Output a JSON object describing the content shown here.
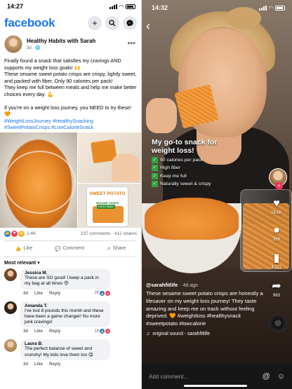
{
  "facebook": {
    "status": {
      "time": "14:27"
    },
    "logo": "facebook",
    "header_icons": [
      "plus-icon",
      "search-icon",
      "messenger-icon"
    ],
    "post": {
      "author": "Healthy Habits with Sarah",
      "time": "3d · ",
      "paragraphs": [
        "Finally found a snack that satisfies my cravings AND supports my weight loss goals! 🙌",
        "These sesame sweet potato crisps are crispy, lightly sweet, and packed with fiber. Only 90 calories per pack!",
        "They keep me full between meals and help me make better choices every day. 💪",
        "If you're on a weight loss journey, you NEED to try these! 🧡"
      ],
      "hashtags": "#WeightLossJourney #HealthySnacking #SweetPotatoCrisps #LowCalorieSnack",
      "bag": {
        "title": "SWEET POTATO",
        "subtitle": "SESAME CRISPS",
        "badge": "HIGH FIBER"
      },
      "reactions": {
        "count": "1.4K",
        "comments": "237 comments",
        "shares": "412 shares"
      },
      "actions": {
        "like": "Like",
        "comment": "Comment",
        "share": "Share"
      }
    },
    "comments_sort": "Most relevant",
    "comments": [
      {
        "name": "Jessica M.",
        "text": "These are SO good! I keep a pack in my bag at all times 😍",
        "time": "3d",
        "like": "Like",
        "reply": "Reply",
        "count": "28"
      },
      {
        "name": "Amanda T.",
        "text": "I've lost 8 pounds this month and these have been a game changer! No more junk cravings!",
        "time": "3d",
        "like": "Like",
        "reply": "Reply",
        "count": "19"
      },
      {
        "name": "Laura B.",
        "text": "The perfect balance of sweet and crunchy! My kids love them too 😋",
        "time": "3d",
        "like": "Like",
        "reply": "Reply",
        "count": ""
      }
    ]
  },
  "tiktok": {
    "status": {
      "time": "14:32"
    },
    "overlay": {
      "title": "My go-to snack for weight loss!",
      "checks": [
        "90 calories per pack",
        "High fiber",
        "Keep me full",
        "Naturally sweet & crispy"
      ]
    },
    "side": {
      "likes": "18.6K",
      "comments": "356",
      "saves": "4,221",
      "shares": "963"
    },
    "caption": {
      "user": "@sarahfitlife",
      "age": "· 4d ago",
      "text": "These sesame sweet potato crisps are honestly a lifesaver on my weight loss journey! They taste amazing and keep me on track without feeling deprived. 🧡 #weightloss #healthysnack #sweetpotato #lowcalorie",
      "sound": "original sound - sarahfitlife"
    },
    "input_placeholder": "Add comment..."
  }
}
